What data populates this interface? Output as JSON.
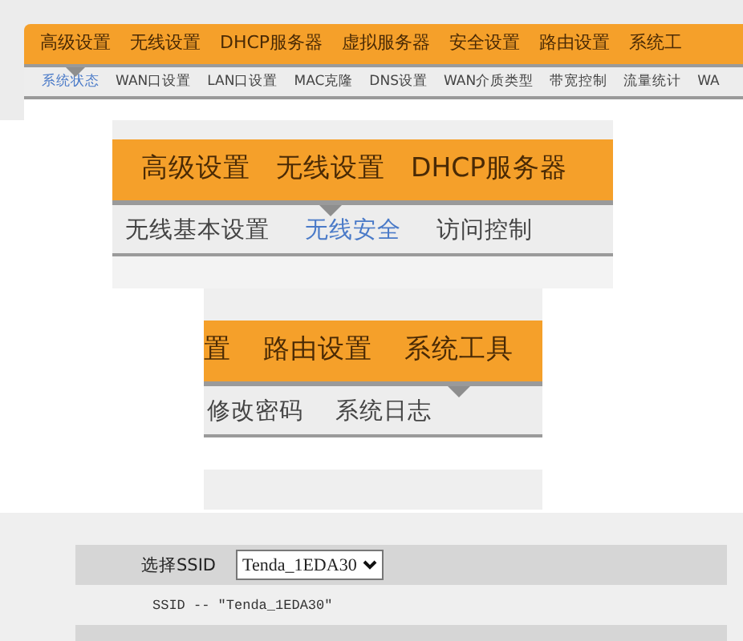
{
  "panels": [
    {
      "kind": "nav",
      "main_menu": [
        {
          "label": "高级设置",
          "selected": true
        },
        {
          "label": "无线设置",
          "selected": false
        },
        {
          "label": "DHCP服务器",
          "selected": false
        },
        {
          "label": "虚拟服务器",
          "selected": false
        },
        {
          "label": "安全设置",
          "selected": false
        },
        {
          "label": "路由设置",
          "selected": false
        },
        {
          "label": "系统工",
          "selected": false
        }
      ],
      "sub_menu": [
        {
          "label": "系统状态",
          "selected": true
        },
        {
          "label": "WAN口设置",
          "selected": false
        },
        {
          "label": "LAN口设置",
          "selected": false
        },
        {
          "label": "MAC克隆",
          "selected": false
        },
        {
          "label": "DNS设置",
          "selected": false
        },
        {
          "label": "WAN介质类型",
          "selected": false
        },
        {
          "label": "带宽控制",
          "selected": false
        },
        {
          "label": "流量统计",
          "selected": false
        },
        {
          "label": "WA",
          "selected": false
        }
      ]
    },
    {
      "kind": "nav",
      "main_menu": [
        {
          "label": "高级设置",
          "selected": false
        },
        {
          "label": "无线设置",
          "selected": true
        },
        {
          "label": "DHCP服务器",
          "selected": false
        }
      ],
      "sub_menu": [
        {
          "label": "无线基本设置",
          "selected": false
        },
        {
          "label": "无线安全",
          "selected": true
        },
        {
          "label": "访问控制",
          "selected": false
        }
      ]
    },
    {
      "kind": "nav",
      "main_menu": [
        {
          "label": "置",
          "selected": false
        },
        {
          "label": "路由设置",
          "selected": false
        },
        {
          "label": "系统工具",
          "selected": true
        }
      ],
      "sub_menu": [
        {
          "label": "修改密码",
          "selected": false
        },
        {
          "label": "系统日志",
          "selected": false
        }
      ]
    },
    {
      "kind": "form",
      "rows": [
        {
          "kind": "select",
          "label": "选择SSID",
          "value": "Tenda_1EDA30"
        },
        {
          "kind": "note",
          "text": "SSID -- \"Tenda_1EDA30\""
        },
        {
          "kind": "band"
        }
      ]
    }
  ]
}
